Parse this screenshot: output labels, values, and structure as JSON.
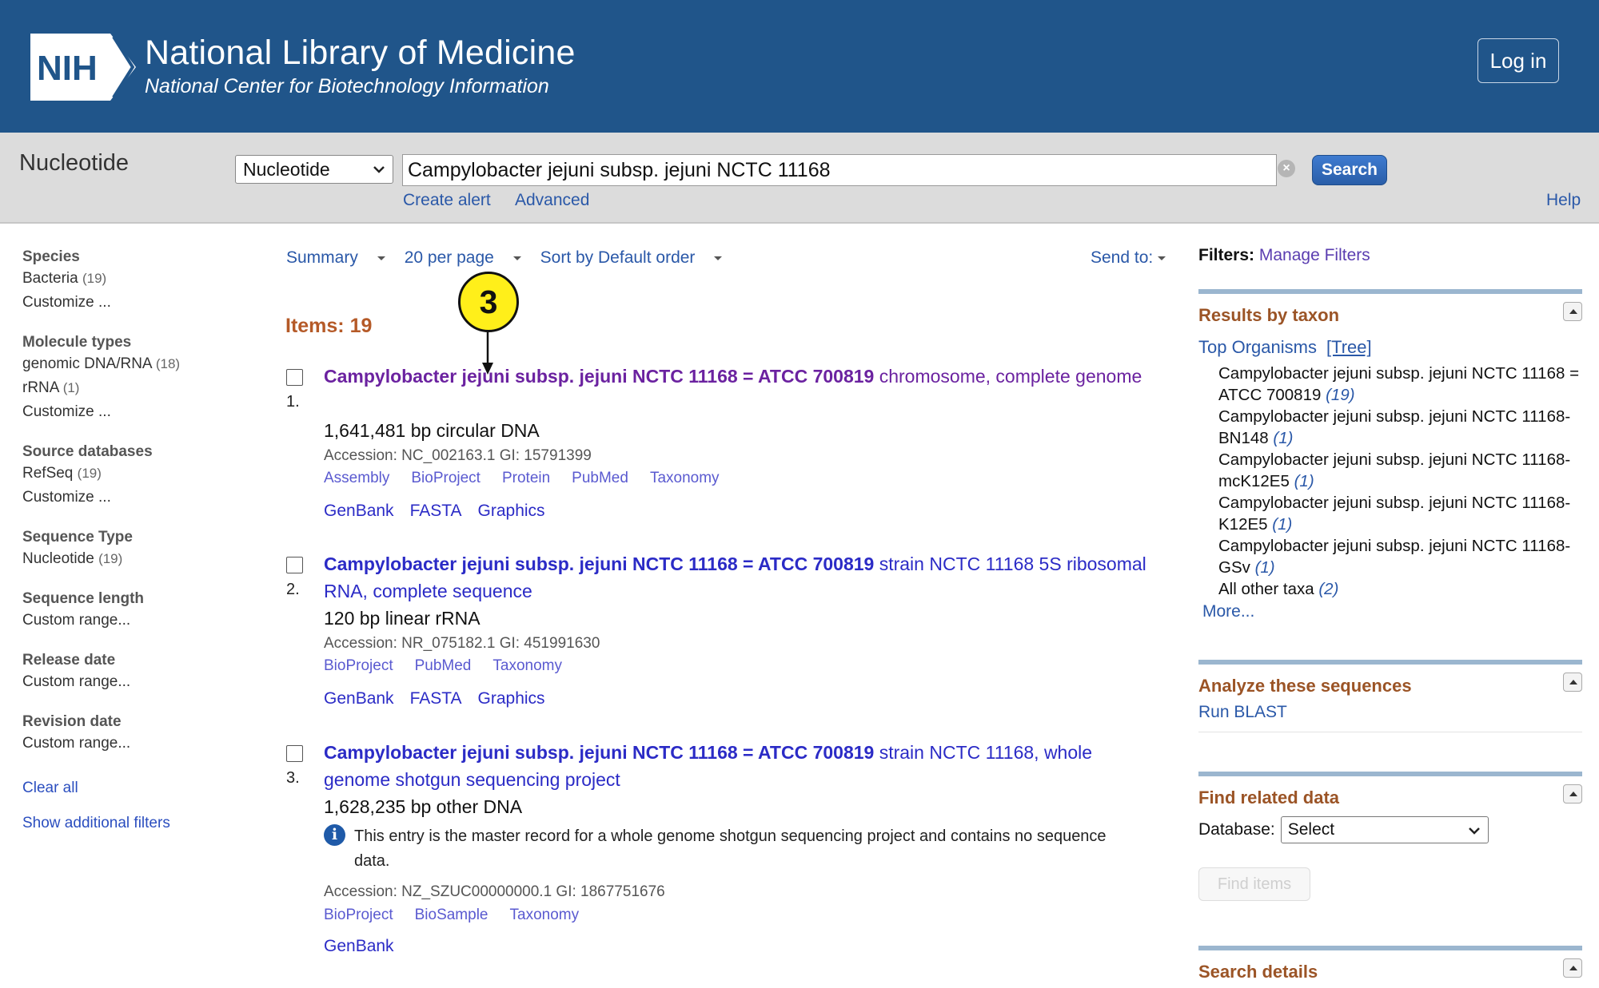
{
  "header": {
    "logo_text": "NIH",
    "title": "National Library of Medicine",
    "subtitle": "National Center for Biotechnology Information",
    "login_label": "Log in"
  },
  "search": {
    "db_title": "Nucleotide",
    "db_selected": "Nucleotide",
    "query": "Campylobacter jejuni subsp. jejuni NCTC 11168",
    "button_label": "Search",
    "create_alert": "Create alert",
    "advanced": "Advanced",
    "help": "Help"
  },
  "sidebar": {
    "facets": [
      {
        "title": "Species",
        "items": [
          {
            "label": "Bacteria",
            "count": "(19)"
          }
        ],
        "custom": "Customize ..."
      },
      {
        "title": "Molecule types",
        "items": [
          {
            "label": "genomic DNA/RNA",
            "count": "(18)"
          },
          {
            "label": "rRNA",
            "count": "(1)"
          }
        ],
        "custom": "Customize ..."
      },
      {
        "title": "Source databases",
        "items": [
          {
            "label": "RefSeq",
            "count": "(19)"
          }
        ],
        "custom": "Customize ..."
      },
      {
        "title": "Sequence Type",
        "items": [
          {
            "label": "Nucleotide",
            "count": "(19)"
          }
        ],
        "custom": ""
      },
      {
        "title": "Sequence length",
        "items": [],
        "custom": "Custom range..."
      },
      {
        "title": "Release date",
        "items": [],
        "custom": "Custom range..."
      },
      {
        "title": "Revision date",
        "items": [],
        "custom": "Custom range..."
      }
    ],
    "clear_all": "Clear all",
    "show_filters": "Show additional filters"
  },
  "toolbar": {
    "summary": "Summary",
    "per_page": "20 per page",
    "sort": "Sort by Default order",
    "send_to": "Send to:"
  },
  "items_count": "Items: 19",
  "marker_label": "3",
  "results": [
    {
      "num": "1.",
      "title_bold": "Campylobacter jejuni subsp. jejuni NCTC 11168 = ATCC 700819",
      "title_rest": " chromosome, complete genome",
      "desc": "1,641,481 bp circular DNA",
      "accession": "Accession: NC_002163.1    GI: 15791399",
      "links1": [
        "Assembly",
        "BioProject",
        "Protein",
        "PubMed",
        "Taxonomy"
      ],
      "links2": [
        "GenBank",
        "FASTA",
        "Graphics"
      ]
    },
    {
      "num": "2.",
      "title_bold": "Campylobacter jejuni subsp. jejuni NCTC 11168 = ATCC 700819",
      "title_rest": " strain NCTC 11168 5S ribosomal RNA, complete sequence",
      "desc": "120 bp linear rRNA",
      "accession": "Accession: NR_075182.1    GI: 451991630",
      "links1": [
        "BioProject",
        "PubMed",
        "Taxonomy"
      ],
      "links2": [
        "GenBank",
        "FASTA",
        "Graphics"
      ]
    },
    {
      "num": "3.",
      "title_bold": "Campylobacter jejuni subsp. jejuni NCTC 11168 = ATCC 700819",
      "title_rest": " strain NCTC 11168, whole genome shotgun sequencing project",
      "desc": "1,628,235 bp other DNA",
      "info": "This entry is the master record for a whole genome shotgun sequencing project and contains no sequence data.",
      "accession": "Accession: NZ_SZUC00000000.1    GI: 1867751676",
      "links1": [
        "BioProject",
        "BioSample",
        "Taxonomy"
      ],
      "links2": [
        "GenBank"
      ]
    }
  ],
  "right": {
    "filters_label": "Filters:",
    "manage_filters": "Manage Filters",
    "taxon_title": "Results by taxon",
    "top_organisms": "Top Organisms",
    "tree": "[Tree]",
    "taxa": [
      {
        "name": "Campylobacter jejuni subsp. jejuni NCTC 11168 = ATCC 700819",
        "count": "(19)"
      },
      {
        "name": "Campylobacter jejuni subsp. jejuni NCTC 11168-BN148",
        "count": "(1)"
      },
      {
        "name": "Campylobacter jejuni subsp. jejuni NCTC 11168-mcK12E5",
        "count": "(1)"
      },
      {
        "name": "Campylobacter jejuni subsp. jejuni NCTC 11168-K12E5",
        "count": "(1)"
      },
      {
        "name": "Campylobacter jejuni subsp. jejuni NCTC 11168-GSv",
        "count": "(1)"
      },
      {
        "name": "All other taxa",
        "count": "(2)"
      }
    ],
    "more": "More...",
    "analyze_title": "Analyze these sequences",
    "run_blast": "Run BLAST",
    "related_title": "Find related data",
    "database_label": "Database:",
    "database_selected": "Select",
    "find_items": "Find items",
    "details_title": "Search details"
  }
}
